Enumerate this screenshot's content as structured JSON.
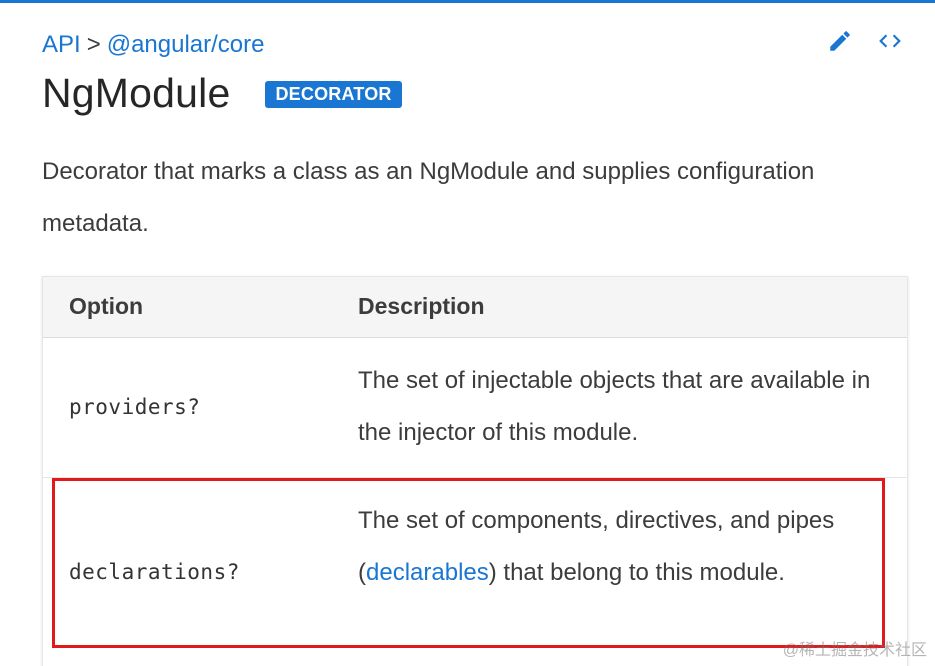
{
  "breadcrumb": {
    "api_label": "API",
    "separator": ">",
    "package_label": "@angular/core"
  },
  "actions": {
    "edit_icon": "pencil-icon",
    "source_icon": "code-brackets-icon"
  },
  "header": {
    "title": "NgModule",
    "badge": "DECORATOR"
  },
  "description": "Decorator that marks a class as an NgModule and supplies configuration metadata.",
  "table": {
    "headers": {
      "option": "Option",
      "description": "Description"
    },
    "rows": [
      {
        "option": "providers?",
        "description": "The set of injectable objects that are available in the injector of this module."
      },
      {
        "option": "declarations?",
        "description_before": "The set of components, directives, and pipes (",
        "description_link": "declarables",
        "description_after": ") that belong to this module."
      }
    ]
  },
  "watermark": "@稀土掘金技术社区",
  "colors": {
    "accent": "#1976d2",
    "highlight": "#e0191b",
    "text": "#3c3c3c"
  }
}
